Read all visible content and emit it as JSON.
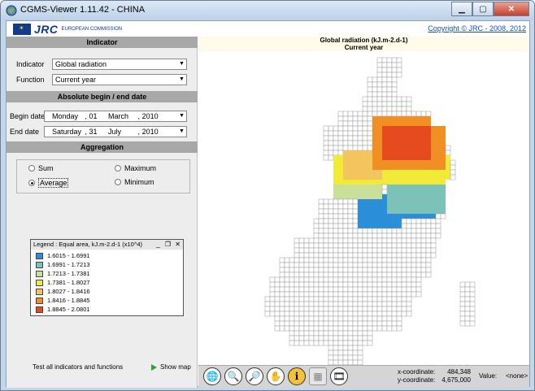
{
  "window": {
    "title": "CGMS-Viewer 1.11.42 - CHINA"
  },
  "header": {
    "logo_jrc": "JRC",
    "logo_ec": "European Commission",
    "copyright": "Copyright © JRC - 2008, 2012"
  },
  "indicator": {
    "section": "Indicator",
    "indicator_label": "Indicator",
    "indicator_value": "Global radiation",
    "function_label": "Function",
    "function_value": "Current year"
  },
  "dates": {
    "section": "Absolute begin / end date",
    "begin_label": "Begin date",
    "begin_day": "Monday",
    "begin_d": "01",
    "begin_m": "March",
    "begin_y": "2010",
    "end_label": "End date",
    "end_day": "Saturday",
    "end_d": "31",
    "end_m": "July",
    "end_y": "2010"
  },
  "aggregation": {
    "section": "Aggregation",
    "sum": "Sum",
    "maximum": "Maximum",
    "average": "Average",
    "minimum": "Minimum",
    "selected": "Average"
  },
  "legend": {
    "title": "Legend : Equal area, kJ.m-2.d-1 (x10^4)",
    "items": [
      {
        "label": "1.6015 - 1.6991",
        "color": "#2a8fd8"
      },
      {
        "label": "1.6991 - 1.7213",
        "color": "#7cc2b8"
      },
      {
        "label": "1.7213 - 1.7381",
        "color": "#c9df9a"
      },
      {
        "label": "1.7381 - 1.8027",
        "color": "#f2ea38"
      },
      {
        "label": "1.8027 - 1.8416",
        "color": "#f3c55e"
      },
      {
        "label": "1.8416 - 1.8845",
        "color": "#f08f24"
      },
      {
        "label": "1.8845 - 2.0801",
        "color": "#e64a1f"
      }
    ]
  },
  "bottom": {
    "test_label": "Test all indicators and functions",
    "show_map": "Show map"
  },
  "map": {
    "title": "Global radiation (kJ.m-2.d-1)",
    "subtitle": "Current year",
    "grid_color": "#9a9a9a"
  },
  "status": {
    "x_label": "x-coordinate:",
    "x_value": "484,348",
    "y_label": "y-coordinate:",
    "y_value": "4,675,000",
    "value_label": "Value:",
    "value": "<none>"
  },
  "tools": [
    "globe-icon",
    "zoom-in-icon",
    "zoom-out-icon",
    "pan-hand-icon",
    "info-icon",
    "chart-icon",
    "film-icon"
  ]
}
